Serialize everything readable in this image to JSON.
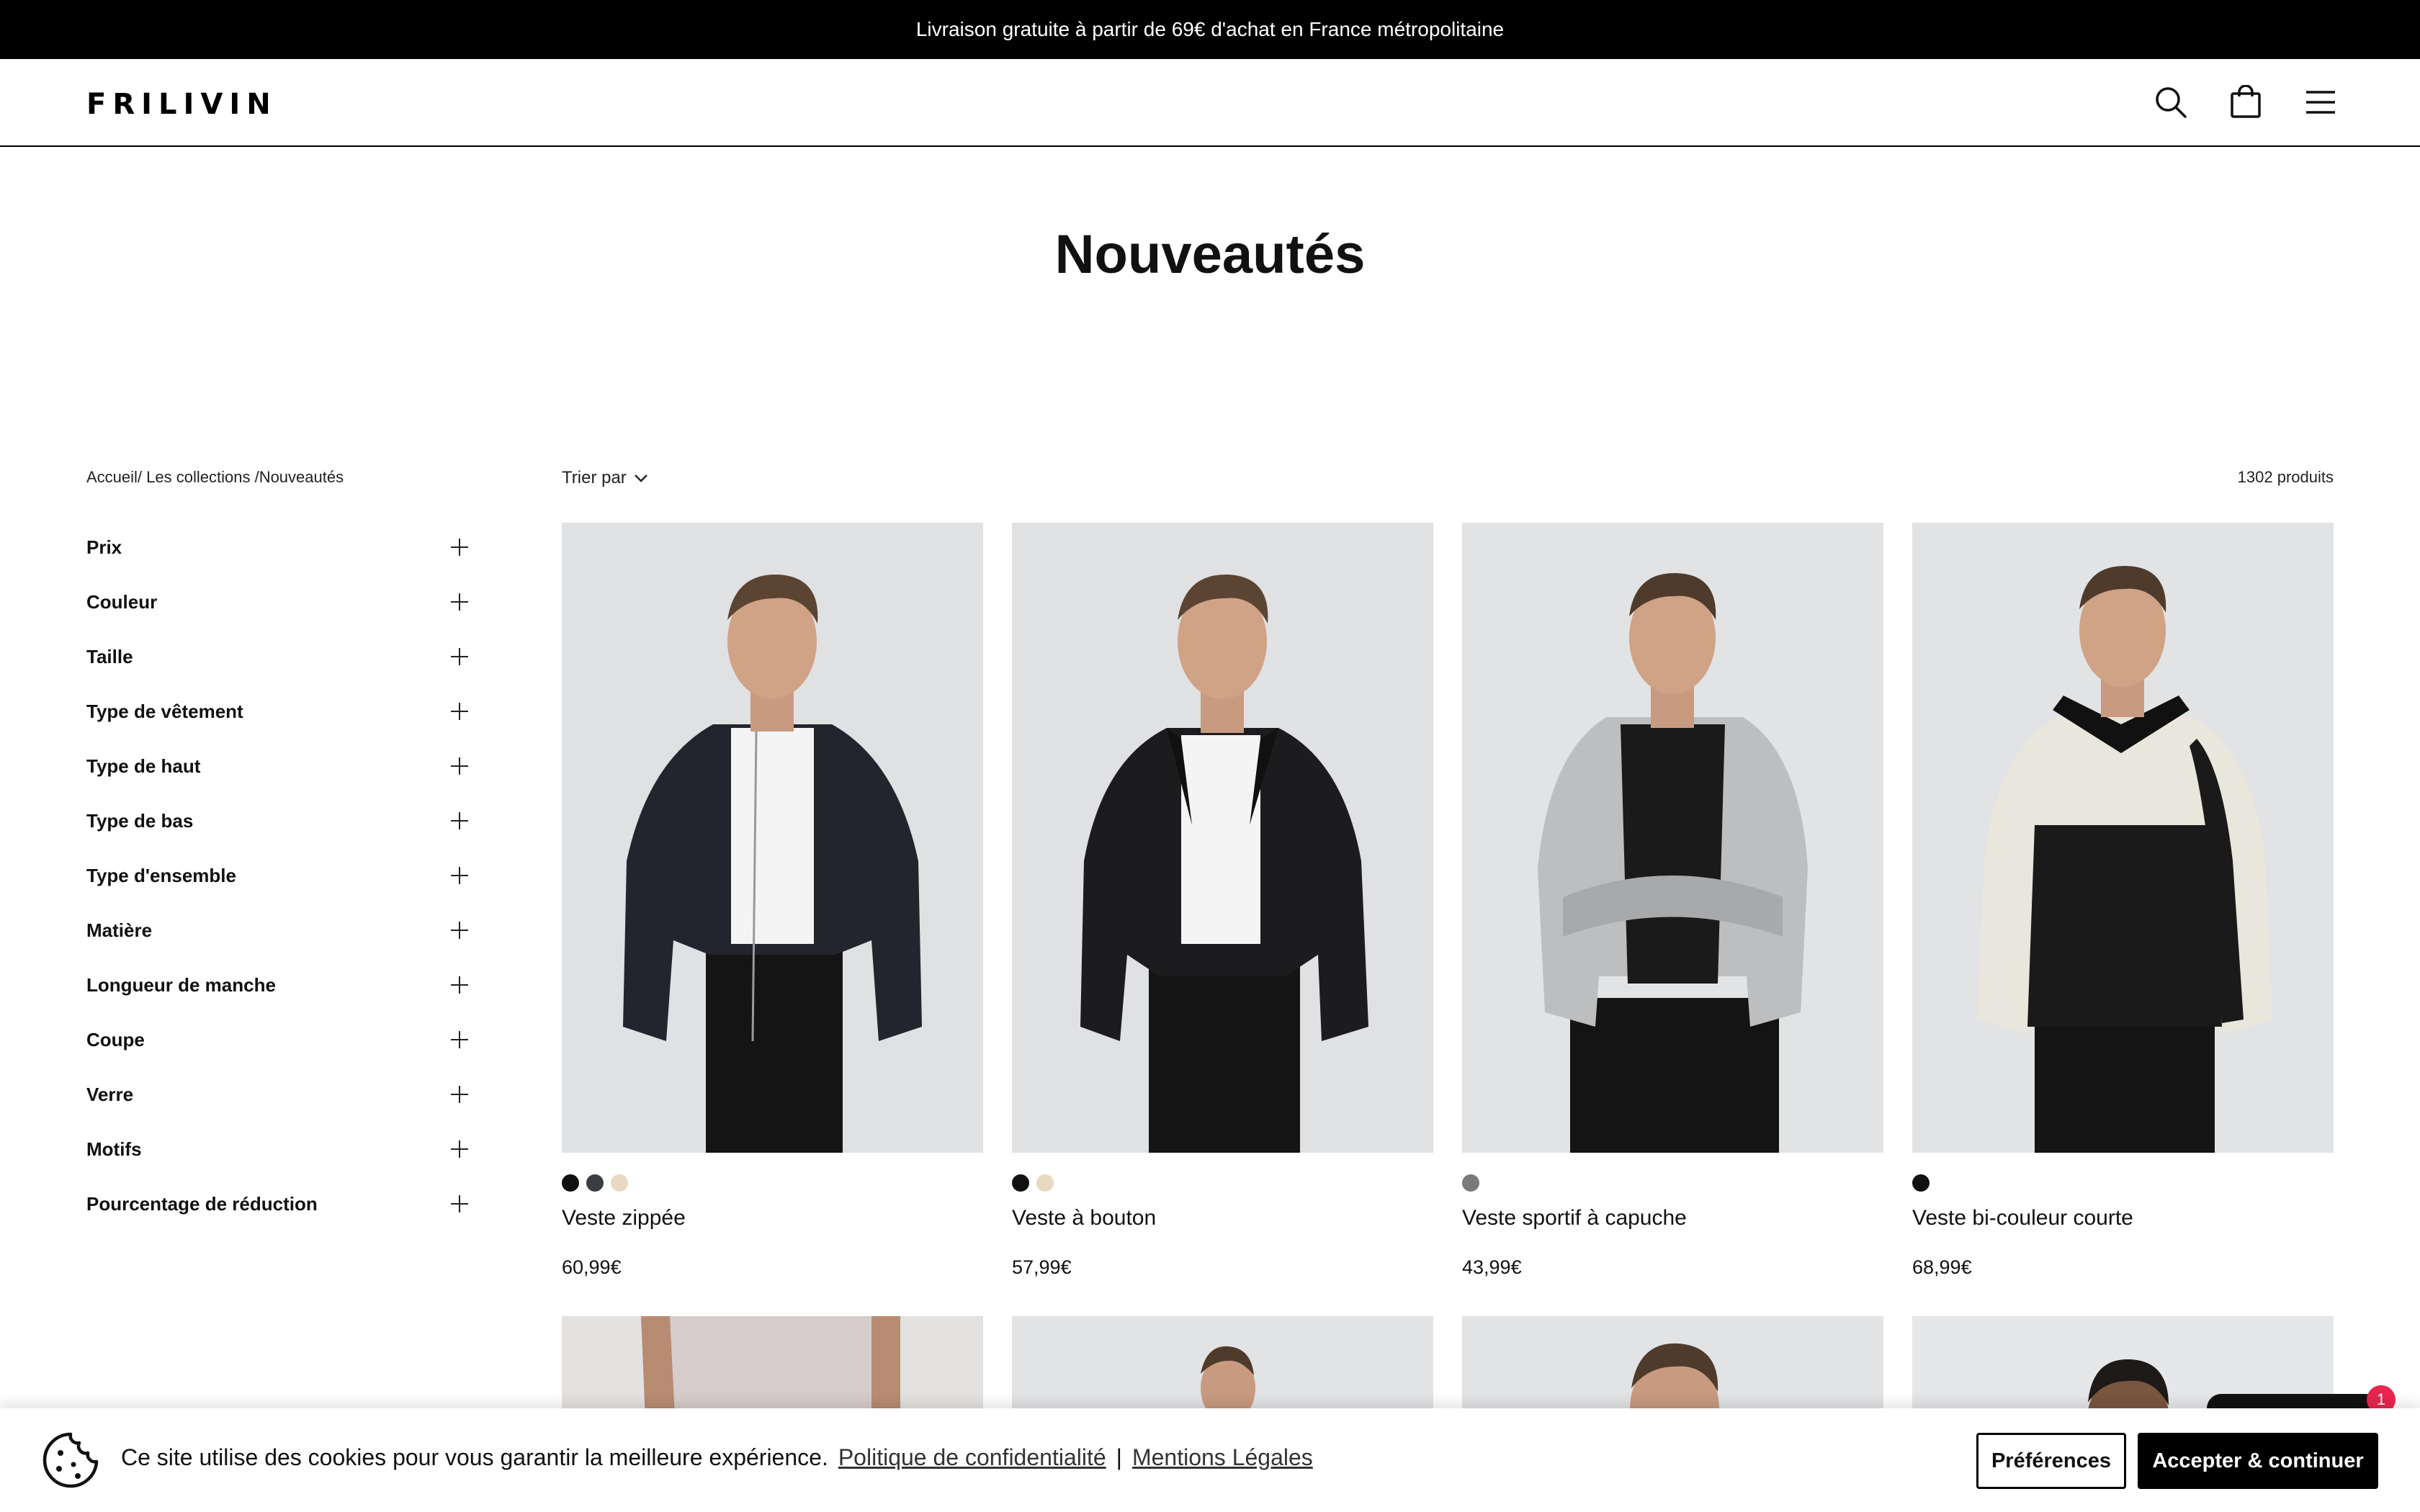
{
  "announcement": "Livraison gratuite à partir de 69€ d'achat en France métropolitaine",
  "header": {
    "logo": "FRILIVIN",
    "icons": [
      "search-icon",
      "shopping-bag-icon",
      "menu-icon"
    ]
  },
  "page_title": "Nouveautés",
  "breadcrumb": {
    "home": "Accueil/",
    "collections": " Les collections /",
    "current": "Nouveautés"
  },
  "sort_label": "Trier par",
  "product_count": "1302 produits",
  "filters": [
    "Prix",
    "Couleur",
    "Taille",
    "Type de vêtement",
    "Type de haut",
    "Type de bas",
    "Type d'ensemble",
    "Matière",
    "Longueur de manche",
    "Coupe",
    "Verre",
    "Motifs",
    "Pourcentage de réduction"
  ],
  "products": [
    {
      "name": "Veste zippée",
      "price": "60,99€",
      "swatches": [
        "#111111",
        "#3a3d42",
        "#e8d9c2"
      ]
    },
    {
      "name": "Veste à bouton",
      "price": "57,99€",
      "swatches": [
        "#111111",
        "#e8d9c2"
      ]
    },
    {
      "name": "Veste sportif à capuche",
      "price": "43,99€",
      "swatches": [
        "#7a7a7a"
      ]
    },
    {
      "name": "Veste bi-couleur courte",
      "price": "68,99€",
      "swatches": [
        "#111111"
      ]
    }
  ],
  "cookie": {
    "text": "Ce site utilise des cookies pour vous garantir la meilleure expérience.",
    "privacy_link": "Politique de confidentialité",
    "separator": "|",
    "legal_link": "Mentions Légales",
    "preferences_button": "Préférences",
    "accept_button": "Accepter & continuer"
  },
  "chat_badge": "1"
}
